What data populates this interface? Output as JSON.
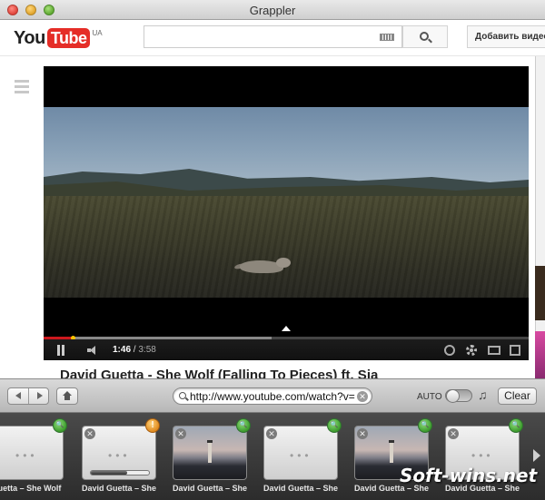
{
  "window": {
    "title": "Grappler"
  },
  "youtube": {
    "logo_you": "You",
    "logo_tube": "Tube",
    "logo_region": "UA",
    "search_placeholder": "",
    "upload_label": "Добавить видео",
    "player": {
      "current_time": "1:46",
      "separator": " / ",
      "total_time": "3:58",
      "played_fraction": 0.0595,
      "buffered_fraction": 0.47
    },
    "video_title": "David Guetta - She Wolf (Falling To Pieces) ft. Sia"
  },
  "toolbar": {
    "url": "http://www.youtube.com/watch?v=",
    "auto_label": "AUTO",
    "auto_enabled": false,
    "clear_label": "Clear"
  },
  "downloads": {
    "items": [
      {
        "label": "Guetta – She Wolf",
        "thumb": "placeholder",
        "status": "done",
        "closable": false
      },
      {
        "label": "David Guetta – She Wolf",
        "thumb": "placeholder",
        "status": "warning",
        "closable": true,
        "progress": 0.62
      },
      {
        "label": "David Guetta – She Wolf",
        "thumb": "photo",
        "status": "done",
        "closable": true
      },
      {
        "label": "David Guetta – She Wolf",
        "thumb": "placeholder",
        "status": "done",
        "closable": true
      },
      {
        "label": "David Guetta – She Wolf",
        "thumb": "photo",
        "status": "done",
        "closable": true
      },
      {
        "label": "David Guetta – She Wolf",
        "thumb": "placeholder",
        "status": "done",
        "closable": true
      }
    ]
  },
  "watermark": "Soft-wins.net",
  "colors": {
    "accent_red": "#e52d27",
    "progress_red": "#cc181e",
    "badge_green": "#3c9a2c",
    "badge_orange": "#e08a1e"
  }
}
